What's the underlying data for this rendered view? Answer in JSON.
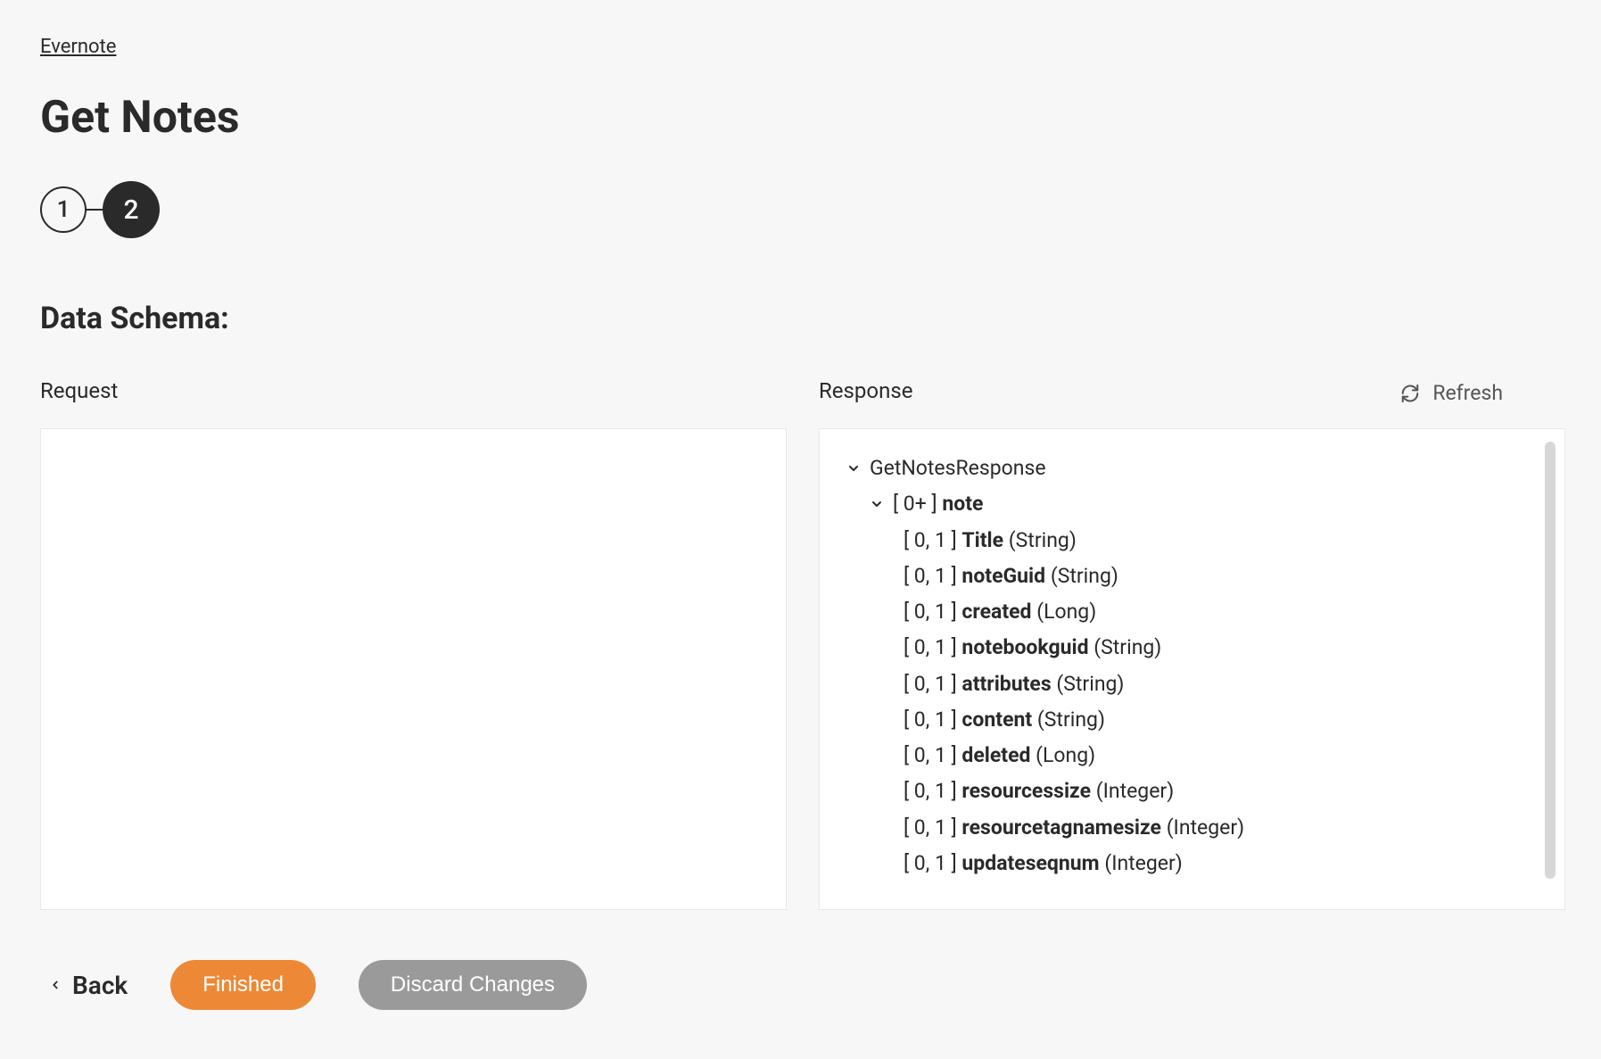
{
  "breadcrumb": "Evernote",
  "pageTitle": "Get Notes",
  "stepper": {
    "step1": "1",
    "step2": "2"
  },
  "sectionTitle": "Data Schema:",
  "refreshLabel": "Refresh",
  "panels": {
    "requestLabel": "Request",
    "responseLabel": "Response"
  },
  "responseTree": {
    "root": "GetNotesResponse",
    "noteCard": "[ 0+ ]",
    "noteName": "note",
    "fields": [
      {
        "card": "[ 0, 1 ]",
        "name": "Title",
        "type": "(String)"
      },
      {
        "card": "[ 0, 1 ]",
        "name": "noteGuid",
        "type": "(String)"
      },
      {
        "card": "[ 0, 1 ]",
        "name": "created",
        "type": "(Long)"
      },
      {
        "card": "[ 0, 1 ]",
        "name": "notebookguid",
        "type": "(String)"
      },
      {
        "card": "[ 0, 1 ]",
        "name": "attributes",
        "type": "(String)"
      },
      {
        "card": "[ 0, 1 ]",
        "name": "content",
        "type": "(String)"
      },
      {
        "card": "[ 0, 1 ]",
        "name": "deleted",
        "type": "(Long)"
      },
      {
        "card": "[ 0, 1 ]",
        "name": "resourcessize",
        "type": "(Integer)"
      },
      {
        "card": "[ 0, 1 ]",
        "name": "resourcetagnamesize",
        "type": "(Integer)"
      },
      {
        "card": "[ 0, 1 ]",
        "name": "updateseqnum",
        "type": "(Integer)"
      }
    ]
  },
  "footer": {
    "back": "Back",
    "finished": "Finished",
    "discard": "Discard Changes"
  }
}
